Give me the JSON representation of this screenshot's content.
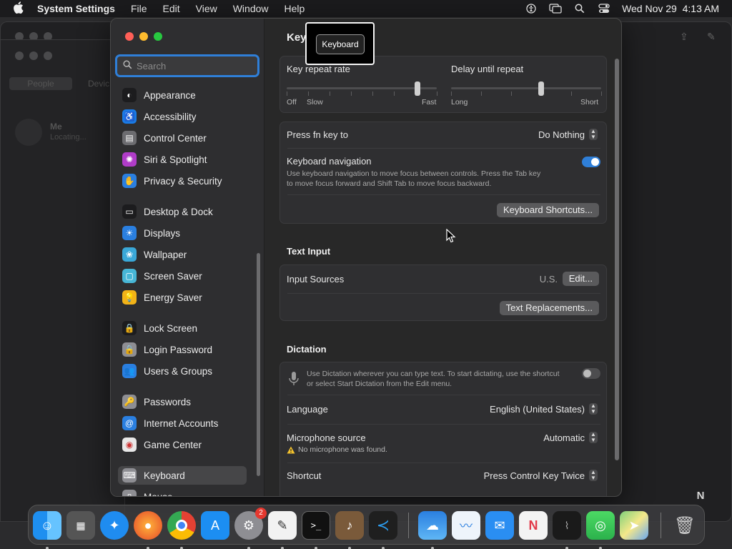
{
  "menubar": {
    "app_name": "System Settings",
    "items": [
      "File",
      "Edit",
      "View",
      "Window",
      "Help"
    ],
    "datetime": "Wed Nov 29  4:13 AM"
  },
  "background_app": {
    "tabs": [
      "People",
      "Devic"
    ],
    "me_name": "Me",
    "me_status": "Locating..."
  },
  "search": {
    "placeholder": "Search",
    "value": ""
  },
  "sidebar": {
    "items": [
      {
        "label": "Appearance",
        "icon": "appearance-icon",
        "color": "#1c1c1e"
      },
      {
        "label": "Accessibility",
        "icon": "accessibility-icon",
        "color": "#1a7ae6"
      },
      {
        "label": "Control Center",
        "icon": "control-center-icon",
        "color": "#6c6c70"
      },
      {
        "label": "Siri & Spotlight",
        "icon": "siri-icon",
        "color": "#b03cc8"
      },
      {
        "label": "Privacy & Security",
        "icon": "hand-icon",
        "color": "#2a7fe0"
      },
      {
        "label": "Desktop & Dock",
        "icon": "dock-icon",
        "color": "#1c1c1e"
      },
      {
        "label": "Displays",
        "icon": "sun-icon",
        "color": "#2a7fe0"
      },
      {
        "label": "Wallpaper",
        "icon": "wallpaper-icon",
        "color": "#3aa8d8"
      },
      {
        "label": "Screen Saver",
        "icon": "screen-saver-icon",
        "color": "#47b6d6"
      },
      {
        "label": "Energy Saver",
        "icon": "bulb-icon",
        "color": "#f2b318"
      },
      {
        "label": "Lock Screen",
        "icon": "lock-icon",
        "color": "#1c1c1e"
      },
      {
        "label": "Login Password",
        "icon": "login-lock-icon",
        "color": "#8e8e93"
      },
      {
        "label": "Users & Groups",
        "icon": "users-icon",
        "color": "#2a7fe0"
      },
      {
        "label": "Passwords",
        "icon": "key-icon",
        "color": "#8e8e93"
      },
      {
        "label": "Internet Accounts",
        "icon": "at-icon",
        "color": "#2a7fe0"
      },
      {
        "label": "Game Center",
        "icon": "game-center-icon",
        "color": "#e8e8e8"
      },
      {
        "label": "Keyboard",
        "icon": "keyboard-icon",
        "color": "#8e8e93"
      },
      {
        "label": "Mouse",
        "icon": "mouse-icon",
        "color": "#8e8e93"
      }
    ]
  },
  "content": {
    "title": "Key",
    "tooltip": "Keyboard",
    "key_repeat": {
      "label": "Key repeat rate",
      "min_labels": [
        "Off",
        "Slow"
      ],
      "max_label": "Fast",
      "value": 0.87
    },
    "delay_repeat": {
      "label": "Delay until repeat",
      "min_label": "Long",
      "max_label": "Short",
      "value": 0.6
    },
    "fn_key": {
      "label": "Press fn key to",
      "value": "Do Nothing"
    },
    "keyboard_nav": {
      "label": "Keyboard navigation",
      "desc1": "Use keyboard navigation to move focus between controls. Press the Tab key",
      "desc2": "to move focus forward and Shift Tab to move focus backward.",
      "on": true
    },
    "shortcuts_button": "Keyboard Shortcuts...",
    "text_input": {
      "title": "Text Input",
      "input_sources_label": "Input Sources",
      "input_sources_value": "U.S.",
      "edit_button": "Edit...",
      "replacements_button": "Text Replacements..."
    },
    "dictation": {
      "title": "Dictation",
      "desc1": "Use Dictation wherever you can type text. To start dictating, use the shortcut",
      "desc2": "or select Start Dictation from the Edit menu.",
      "on": false,
      "language_label": "Language",
      "language_value": "English (United States)",
      "mic_label": "Microphone source",
      "mic_value": "Automatic",
      "mic_warning": "No microphone was found.",
      "shortcut_label": "Shortcut",
      "shortcut_value": "Press Control Key Twice"
    }
  },
  "dock": {
    "badge_count": "2",
    "corner_letter": "N"
  },
  "colors": {
    "accent": "#2f7fd8",
    "close": "#ff5f57",
    "minimize": "#febc2e",
    "zoom": "#28c840",
    "toggle_on": "#2f7fd8"
  }
}
